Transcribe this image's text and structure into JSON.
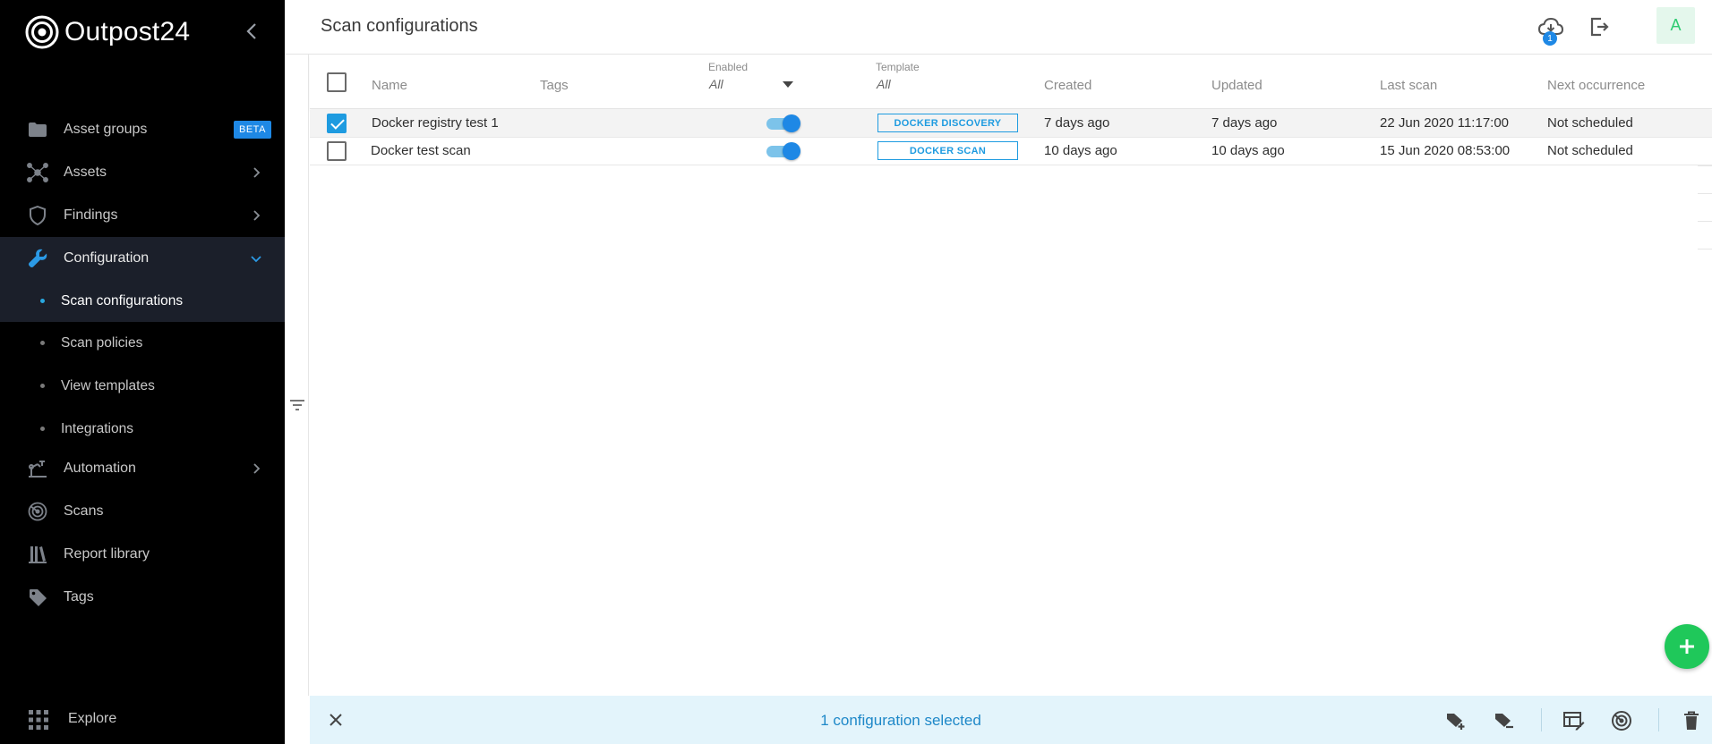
{
  "app": {
    "brand_name": "Outpost",
    "brand_number": "24"
  },
  "sidebar": {
    "items": [
      {
        "label": "Asset groups",
        "icon": "folder-icon",
        "badge": "BETA"
      },
      {
        "label": "Assets",
        "icon": "network-icon"
      },
      {
        "label": "Findings",
        "icon": "shield-icon"
      },
      {
        "label": "Configuration",
        "icon": "wrench-icon"
      },
      {
        "label": "Automation",
        "icon": "automation-icon"
      },
      {
        "label": "Scans",
        "icon": "radar-icon"
      },
      {
        "label": "Report library",
        "icon": "library-icon"
      },
      {
        "label": "Tags",
        "icon": "tag-icon"
      }
    ],
    "sub_items": [
      {
        "label": "Scan configurations"
      },
      {
        "label": "Scan policies"
      },
      {
        "label": "View templates"
      },
      {
        "label": "Integrations"
      }
    ],
    "explore_label": "Explore"
  },
  "header": {
    "title": "Scan configurations",
    "notification_count": "1",
    "avatar_initial": "A"
  },
  "table": {
    "columns": {
      "name": "Name",
      "tags": "Tags",
      "enabled_label": "Enabled",
      "enabled_filter": "All",
      "template_label": "Template",
      "template_filter": "All",
      "created": "Created",
      "updated": "Updated",
      "last_scan": "Last scan",
      "next_occurrence": "Next occurrence"
    },
    "rows": [
      {
        "name": "Docker registry test 1",
        "enabled": true,
        "template": "DOCKER DISCOVERY",
        "created": "7 days ago",
        "updated": "7 days ago",
        "last_scan": "22 Jun 2020 11:17:00",
        "next_occurrence": "Not scheduled",
        "selected": true
      },
      {
        "name": "Docker test scan",
        "enabled": true,
        "template": "DOCKER SCAN",
        "created": "10 days ago",
        "updated": "10 days ago",
        "last_scan": "15 Jun 2020 08:53:00",
        "next_occurrence": "Not scheduled",
        "selected": false
      }
    ]
  },
  "selection_bar": {
    "text": "1 configuration selected"
  },
  "colors": {
    "accent": "#1e88e5",
    "fab": "#1fc85a",
    "sidebar_bg": "#000000",
    "active_bg": "#1b1f2a"
  }
}
